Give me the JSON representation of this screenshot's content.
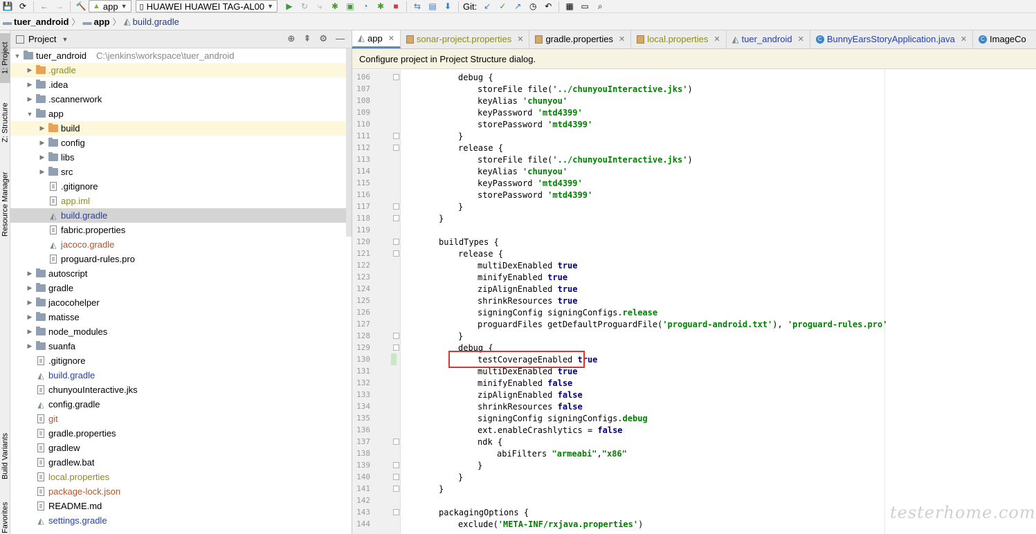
{
  "toolbar": {
    "run_config": "app",
    "device": "HUAWEI HUAWEI TAG-AL00",
    "git_label": "Git:"
  },
  "breadcrumb": {
    "project": "tuer_android",
    "module": "app",
    "file": "build.gradle"
  },
  "left_strip": {
    "project_tab": "1: Project",
    "structure_tab": "Z: Structure",
    "resource_tab": "Resource Manager",
    "variants_tab": "Build Variants",
    "favorites_tab": "Favorites"
  },
  "project_panel": {
    "view_mode": "Project",
    "root_name": "tuer_android",
    "root_path": "C:\\jenkins\\workspace\\tuer_android",
    "items": [
      {
        "label": ".gradle"
      },
      {
        "label": ".idea"
      },
      {
        "label": ".scannerwork"
      },
      {
        "label": "app"
      },
      {
        "label": "build"
      },
      {
        "label": "config"
      },
      {
        "label": "libs"
      },
      {
        "label": "src"
      },
      {
        "label": ".gitignore"
      },
      {
        "label": "app.iml"
      },
      {
        "label": "build.gradle"
      },
      {
        "label": "fabric.properties"
      },
      {
        "label": "jacoco.gradle"
      },
      {
        "label": "proguard-rules.pro"
      },
      {
        "label": "autoscript"
      },
      {
        "label": "gradle"
      },
      {
        "label": "jacocohelper"
      },
      {
        "label": "matisse"
      },
      {
        "label": "node_modules"
      },
      {
        "label": "suanfa"
      },
      {
        "label": ".gitignore"
      },
      {
        "label": "build.gradle"
      },
      {
        "label": "chunyouInteractive.jks"
      },
      {
        "label": "config.gradle"
      },
      {
        "label": "git"
      },
      {
        "label": "gradle.properties"
      },
      {
        "label": "gradlew"
      },
      {
        "label": "gradlew.bat"
      },
      {
        "label": "local.properties"
      },
      {
        "label": "package-lock.json"
      },
      {
        "label": "README.md"
      },
      {
        "label": "settings.gradle"
      }
    ]
  },
  "tabs": [
    {
      "label": "app"
    },
    {
      "label": "sonar-project.properties"
    },
    {
      "label": "gradle.properties"
    },
    {
      "label": "local.properties"
    },
    {
      "label": "tuer_android"
    },
    {
      "label": "BunnyEarsStoryApplication.java"
    },
    {
      "label": "ImageCo"
    }
  ],
  "banner": "Configure project in Project Structure dialog.",
  "code": {
    "lines": [
      {
        "n": "106",
        "indent": 2,
        "parts": [
          {
            "t": "debug {",
            "c": ""
          }
        ]
      },
      {
        "n": "107",
        "indent": 3,
        "parts": [
          {
            "t": "storeFile file(",
            "c": ""
          },
          {
            "t": "'../chunyouInteractive.jks'",
            "c": "str"
          },
          {
            "t": ")",
            "c": ""
          }
        ]
      },
      {
        "n": "108",
        "indent": 3,
        "parts": [
          {
            "t": "keyAlias ",
            "c": ""
          },
          {
            "t": "'chunyou'",
            "c": "str"
          }
        ]
      },
      {
        "n": "109",
        "indent": 3,
        "parts": [
          {
            "t": "keyPassword ",
            "c": ""
          },
          {
            "t": "'mtd4399'",
            "c": "str"
          }
        ]
      },
      {
        "n": "110",
        "indent": 3,
        "parts": [
          {
            "t": "storePassword ",
            "c": ""
          },
          {
            "t": "'mtd4399'",
            "c": "str"
          }
        ]
      },
      {
        "n": "111",
        "indent": 2,
        "parts": [
          {
            "t": "}",
            "c": ""
          }
        ]
      },
      {
        "n": "112",
        "indent": 2,
        "parts": [
          {
            "t": "release {",
            "c": ""
          }
        ]
      },
      {
        "n": "113",
        "indent": 3,
        "parts": [
          {
            "t": "storeFile file(",
            "c": ""
          },
          {
            "t": "'../chunyouInteractive.jks'",
            "c": "str"
          },
          {
            "t": ")",
            "c": ""
          }
        ]
      },
      {
        "n": "114",
        "indent": 3,
        "parts": [
          {
            "t": "keyAlias ",
            "c": ""
          },
          {
            "t": "'chunyou'",
            "c": "str"
          }
        ]
      },
      {
        "n": "115",
        "indent": 3,
        "parts": [
          {
            "t": "keyPassword ",
            "c": ""
          },
          {
            "t": "'mtd4399'",
            "c": "str"
          }
        ]
      },
      {
        "n": "116",
        "indent": 3,
        "parts": [
          {
            "t": "storePassword ",
            "c": ""
          },
          {
            "t": "'mtd4399'",
            "c": "str"
          }
        ]
      },
      {
        "n": "117",
        "indent": 2,
        "parts": [
          {
            "t": "}",
            "c": ""
          }
        ]
      },
      {
        "n": "118",
        "indent": 1,
        "parts": [
          {
            "t": "}",
            "c": ""
          }
        ]
      },
      {
        "n": "119",
        "indent": 0,
        "parts": []
      },
      {
        "n": "120",
        "indent": 1,
        "parts": [
          {
            "t": "buildTypes {",
            "c": ""
          }
        ]
      },
      {
        "n": "121",
        "indent": 2,
        "parts": [
          {
            "t": "release {",
            "c": ""
          }
        ]
      },
      {
        "n": "122",
        "indent": 3,
        "parts": [
          {
            "t": "multiDexEnabled ",
            "c": ""
          },
          {
            "t": "true",
            "c": "kw"
          }
        ]
      },
      {
        "n": "123",
        "indent": 3,
        "parts": [
          {
            "t": "minifyEnabled ",
            "c": ""
          },
          {
            "t": "true",
            "c": "kw"
          }
        ]
      },
      {
        "n": "124",
        "indent": 3,
        "parts": [
          {
            "t": "zipAlignEnabled ",
            "c": ""
          },
          {
            "t": "true",
            "c": "kw"
          }
        ]
      },
      {
        "n": "125",
        "indent": 3,
        "parts": [
          {
            "t": "shrinkResources ",
            "c": ""
          },
          {
            "t": "true",
            "c": "kw"
          }
        ]
      },
      {
        "n": "126",
        "indent": 3,
        "parts": [
          {
            "t": "signingConfig signingConfigs.",
            "c": ""
          },
          {
            "t": "release",
            "c": "str"
          }
        ]
      },
      {
        "n": "127",
        "indent": 3,
        "parts": [
          {
            "t": "proguardFiles getDefaultProguardFile(",
            "c": ""
          },
          {
            "t": "'proguard-android.txt'",
            "c": "str"
          },
          {
            "t": "), ",
            "c": ""
          },
          {
            "t": "'proguard-rules.pro'",
            "c": "str"
          }
        ]
      },
      {
        "n": "128",
        "indent": 2,
        "parts": [
          {
            "t": "}",
            "c": ""
          }
        ]
      },
      {
        "n": "129",
        "indent": 2,
        "parts": [
          {
            "t": "debug {",
            "c": ""
          }
        ]
      },
      {
        "n": "130",
        "indent": 3,
        "parts": [
          {
            "t": "testCoverageEnabled ",
            "c": ""
          },
          {
            "t": "true",
            "c": "kw"
          }
        ]
      },
      {
        "n": "131",
        "indent": 3,
        "parts": [
          {
            "t": "multiDexEnabled ",
            "c": ""
          },
          {
            "t": "true",
            "c": "kw"
          }
        ]
      },
      {
        "n": "132",
        "indent": 3,
        "parts": [
          {
            "t": "minifyEnabled ",
            "c": ""
          },
          {
            "t": "false",
            "c": "kw"
          }
        ]
      },
      {
        "n": "133",
        "indent": 3,
        "parts": [
          {
            "t": "zipAlignEnabled ",
            "c": ""
          },
          {
            "t": "false",
            "c": "kw"
          }
        ]
      },
      {
        "n": "134",
        "indent": 3,
        "parts": [
          {
            "t": "shrinkResources ",
            "c": ""
          },
          {
            "t": "false",
            "c": "kw"
          }
        ]
      },
      {
        "n": "135",
        "indent": 3,
        "parts": [
          {
            "t": "signingConfig signingConfigs.",
            "c": ""
          },
          {
            "t": "debug",
            "c": "str"
          }
        ]
      },
      {
        "n": "136",
        "indent": 3,
        "parts": [
          {
            "t": "ext.enableCrashlytics = ",
            "c": ""
          },
          {
            "t": "false",
            "c": "kw"
          }
        ]
      },
      {
        "n": "137",
        "indent": 3,
        "parts": [
          {
            "t": "ndk {",
            "c": ""
          }
        ]
      },
      {
        "n": "138",
        "indent": 4,
        "parts": [
          {
            "t": "abiFilters ",
            "c": ""
          },
          {
            "t": "\"armeabi\"",
            "c": "str"
          },
          {
            "t": ",",
            "c": ""
          },
          {
            "t": "\"x86\"",
            "c": "str"
          }
        ]
      },
      {
        "n": "139",
        "indent": 3,
        "parts": [
          {
            "t": "}",
            "c": ""
          }
        ]
      },
      {
        "n": "140",
        "indent": 2,
        "parts": [
          {
            "t": "}",
            "c": ""
          }
        ]
      },
      {
        "n": "141",
        "indent": 1,
        "parts": [
          {
            "t": "}",
            "c": ""
          }
        ]
      },
      {
        "n": "142",
        "indent": 0,
        "parts": []
      },
      {
        "n": "143",
        "indent": 1,
        "parts": [
          {
            "t": "packagingOptions {",
            "c": ""
          }
        ]
      },
      {
        "n": "144",
        "indent": 2,
        "parts": [
          {
            "t": "exclude(",
            "c": ""
          },
          {
            "t": "'META-INF/rxjava.properties'",
            "c": "str"
          },
          {
            "t": ")",
            "c": ""
          }
        ]
      }
    ]
  },
  "watermark": "testerhome.com",
  "colors": {
    "highlight_box": "#e5322d",
    "keyword": "#000080",
    "string": "#008000",
    "active_tab_underline": "#4a8cd8"
  }
}
